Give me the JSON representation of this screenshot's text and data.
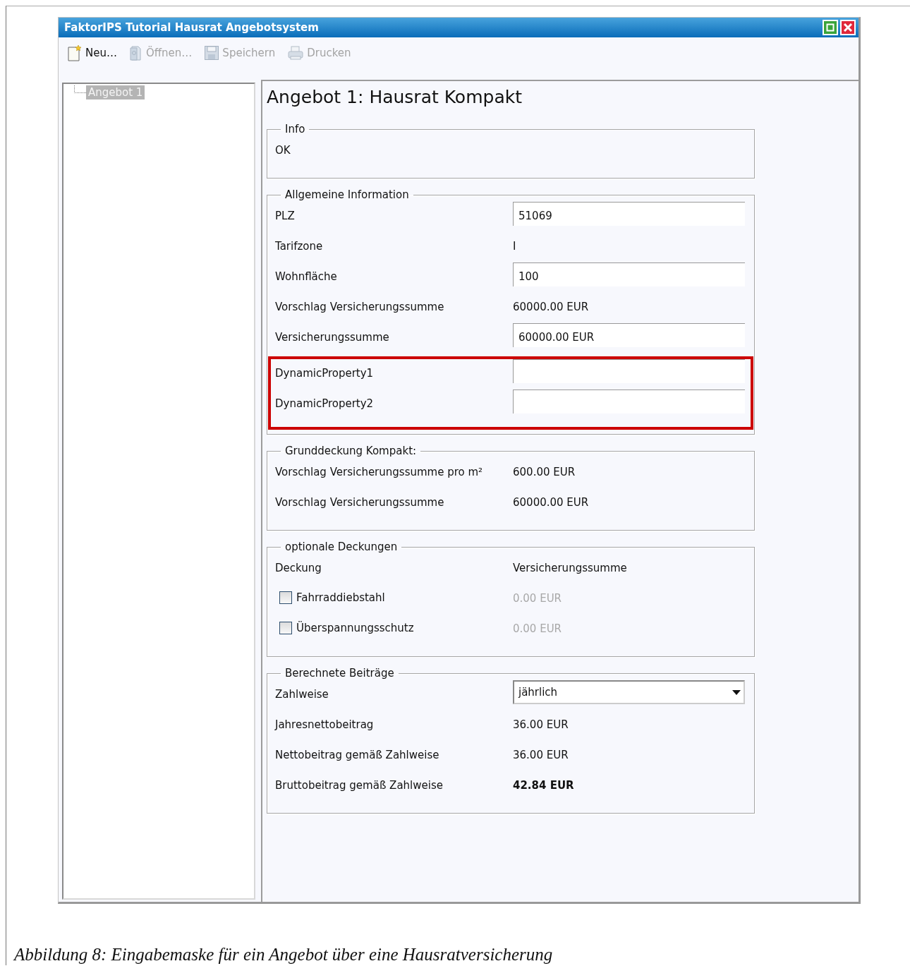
{
  "window": {
    "title": "FaktorIPS Tutorial Hausrat Angebotsystem"
  },
  "toolbar": [
    {
      "label": "Neu…",
      "kind": "new",
      "disabled": false
    },
    {
      "label": "Öffnen…",
      "kind": "open",
      "disabled": true
    },
    {
      "label": "Speichern",
      "kind": "save",
      "disabled": true
    },
    {
      "label": "Drucken",
      "kind": "print",
      "disabled": true
    }
  ],
  "tree": [
    {
      "label": "Angebot 1",
      "selected": true
    }
  ],
  "heading": "Angebot 1: Hausrat Kompakt",
  "sections": [
    {
      "title": "Info",
      "rows": [
        {
          "kind": "text",
          "label": "OK"
        }
      ]
    },
    {
      "title": "Allgemeine Information",
      "rows": [
        {
          "kind": "field",
          "label": "PLZ",
          "value": "51069"
        },
        {
          "kind": "value",
          "label": "Tarifzone",
          "value": "I",
          "bold": false
        },
        {
          "kind": "field",
          "label": "Wohnfläche",
          "value": "100"
        },
        {
          "kind": "value",
          "label": "Vorschlag Versicherungssumme",
          "value": "60000.00 EUR",
          "bold": false
        },
        {
          "kind": "field",
          "label": "Versicherungssumme",
          "value": "60000.00 EUR"
        }
      ],
      "marked_rows": [
        {
          "kind": "field",
          "label": "DynamicProperty1"
        },
        {
          "kind": "field",
          "label": "DynamicProperty2"
        }
      ]
    },
    {
      "title": "Grunddeckung Kompakt:",
      "rows": [
        {
          "kind": "value",
          "label": "Vorschlag Versicherungssumme pro m²",
          "value": "600.00 EUR",
          "bold": false
        },
        {
          "kind": "value",
          "label": "Vorschlag Versicherungssumme",
          "value": "60000.00 EUR",
          "bold": false
        }
      ]
    },
    {
      "title": "optionale Deckungen",
      "rows": [
        {
          "kind": "header",
          "label": "Deckung",
          "value": "Versicherungssumme"
        },
        {
          "kind": "checkbox",
          "label": "Fahrraddiebstahl",
          "checked": false,
          "value": "0.00 EUR",
          "disabled": true
        },
        {
          "kind": "checkbox",
          "label": "Überspannungsschutz",
          "checked": false,
          "value": "0.00 EUR",
          "disabled": true
        }
      ]
    },
    {
      "title": "Berechnete Beiträge",
      "rows": [
        {
          "kind": "select",
          "label": "Zahlweise",
          "value": "jährlich"
        },
        {
          "kind": "value",
          "label": "Jahresnettobeitrag",
          "value": "36.00 EUR",
          "bold": false
        },
        {
          "kind": "value",
          "label": "Nettobeitrag gemäß Zahlweise",
          "value": "36.00 EUR",
          "bold": false
        },
        {
          "kind": "value",
          "label": "Bruttobeitrag gemäß Zahlweise",
          "value": "42.84 EUR",
          "bold": true
        }
      ]
    }
  ],
  "caption": "Abbildung 8: Eingabemaske für ein Angebot über eine Hausratversicherung"
}
